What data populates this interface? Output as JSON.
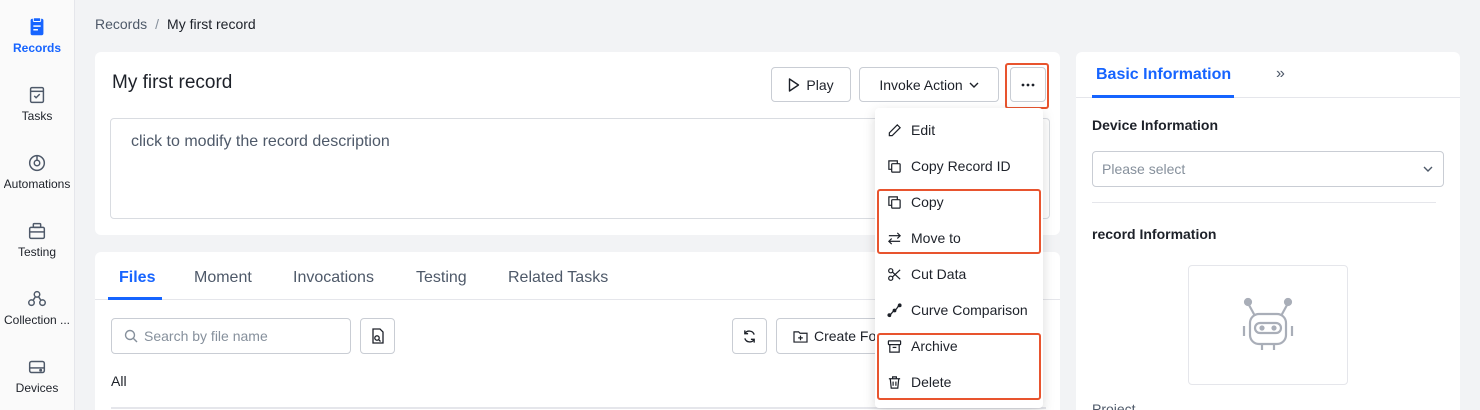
{
  "sidebar": {
    "items": [
      {
        "label": "Records",
        "icon": "records-icon",
        "active": true
      },
      {
        "label": "Tasks",
        "icon": "tasks-icon"
      },
      {
        "label": "Automations",
        "icon": "automations-icon"
      },
      {
        "label": "Testing",
        "icon": "testing-icon"
      },
      {
        "label": "Collection ...",
        "icon": "collection-icon"
      },
      {
        "label": "Devices",
        "icon": "devices-icon"
      }
    ]
  },
  "breadcrumb": {
    "parent": "Records",
    "separator": "/",
    "current": "My first record"
  },
  "record": {
    "title": "My first record",
    "description_placeholder": "click to modify the record description"
  },
  "toolbar": {
    "play_label": "Play",
    "invoke_label": "Invoke Action",
    "more_icon": "ellipsis-icon"
  },
  "files": {
    "tabs": [
      {
        "label": "Files",
        "active": true
      },
      {
        "label": "Moment"
      },
      {
        "label": "Invocations"
      },
      {
        "label": "Testing"
      },
      {
        "label": "Related Tasks"
      }
    ],
    "search_placeholder": "Search by file name",
    "create_label": "Create Fo",
    "filter_all": "All"
  },
  "menu": {
    "items": [
      {
        "label": "Edit",
        "icon": "pencil-icon"
      },
      {
        "label": "Copy Record ID",
        "icon": "copy-icon"
      },
      {
        "label": "Copy",
        "icon": "copy-icon"
      },
      {
        "label": "Move to",
        "icon": "move-icon"
      },
      {
        "label": "Cut Data",
        "icon": "scissors-icon"
      },
      {
        "label": "Curve Comparison",
        "icon": "curve-icon"
      },
      {
        "label": "Archive",
        "icon": "archive-icon"
      },
      {
        "label": "Delete",
        "icon": "trash-icon"
      }
    ]
  },
  "panel": {
    "tab_label": "Basic Information",
    "expand_label": "»",
    "device_section": "Device Information",
    "select_placeholder": "Please select",
    "record_section": "record Information",
    "project_label": "Project"
  },
  "colors": {
    "accent": "#1664ff",
    "highlight": "#e8542e",
    "text": "#1d2129",
    "muted": "#86909c"
  }
}
